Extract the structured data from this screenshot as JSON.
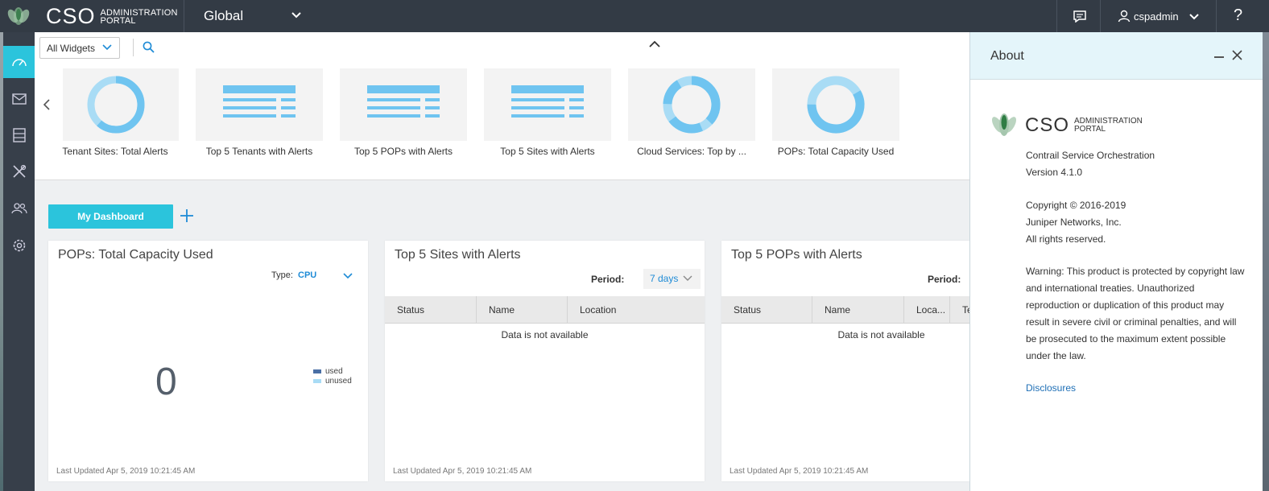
{
  "header": {
    "brand_main": "CSO",
    "brand_sub_line1": "ADMINISTRATION",
    "brand_sub_line2": "PORTAL",
    "scope": "Global",
    "username": "cspadmin",
    "help_label": "?"
  },
  "sidebar": {
    "items": [
      {
        "name": "dashboard-icon",
        "active": true
      },
      {
        "name": "monitor-icon",
        "active": false
      },
      {
        "name": "resources-icon",
        "active": false
      },
      {
        "name": "configuration-icon",
        "active": false
      },
      {
        "name": "users-icon",
        "active": false
      },
      {
        "name": "settings-icon",
        "active": false
      }
    ]
  },
  "widget_bar": {
    "filter_value": "All Widgets",
    "widgets": [
      {
        "label": "Tenant Sites: Total Alerts",
        "icon": "donut-chart-icon"
      },
      {
        "label": "Top 5 Tenants with Alerts",
        "icon": "table-icon"
      },
      {
        "label": "Top 5 POPs with Alerts",
        "icon": "table-icon"
      },
      {
        "label": "Top 5 Sites with Alerts",
        "icon": "table-icon"
      },
      {
        "label": "Cloud Services: Top by ...",
        "icon": "donut-chart-icon"
      },
      {
        "label": "POPs: Total Capacity Used",
        "icon": "donut-chart-icon"
      }
    ]
  },
  "dashboard": {
    "active_tab": "My Dashboard",
    "cards": {
      "capacity": {
        "title": "POPs: Total Capacity Used",
        "type_label": "Type:",
        "type_value": "CPU",
        "value": "0",
        "legend_used": "used",
        "legend_unused": "unused",
        "footer": "Last Updated Apr 5, 2019 10:21:45 AM"
      },
      "sites": {
        "title": "Top 5 Sites with Alerts",
        "period_label": "Period:",
        "period_value": "7 days",
        "columns": [
          "Status",
          "Name",
          "Location"
        ],
        "empty_text": "Data is not available",
        "footer": "Last Updated Apr 5, 2019 10:21:45 AM"
      },
      "pops": {
        "title": "Top 5 POPs with Alerts",
        "period_label": "Period:",
        "columns": [
          "Status",
          "Name",
          "Loca...",
          "Te"
        ],
        "empty_text": "Data is not available",
        "footer": "Last Updated Apr 5, 2019 10:21:45 AM"
      }
    }
  },
  "about": {
    "title": "About",
    "brand_main": "CSO",
    "brand_sub_line1": "ADMINISTRATION",
    "brand_sub_line2": "PORTAL",
    "product_name": "Contrail Service Orchestration",
    "version": "Version 4.1.0",
    "copyright": "Copyright © 2016-2019",
    "company": "Juniper Networks, Inc.",
    "rights": "All rights reserved.",
    "warning": "Warning: This product is protected by copyright law and international treaties. Unauthorized reproduction or duplication of this product may result in severe civil or criminal penalties, and will be prosecuted to the maximum extent possible under the law.",
    "link": "Disclosures"
  },
  "colors": {
    "accent": "#2bc4dc",
    "topbar": "#333b45",
    "sidebar": "#373f4a",
    "link": "#1e8bd6",
    "chart_light": "#a9dcf5",
    "chart_dark": "#6fc4f0",
    "legend_used": "#4a6fa5",
    "legend_unused": "#a9dcf5"
  }
}
